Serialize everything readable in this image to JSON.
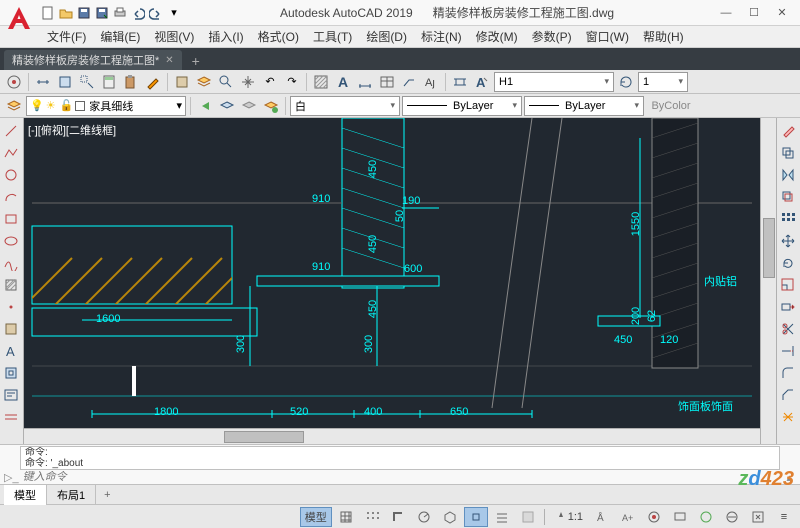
{
  "title": {
    "app": "Autodesk AutoCAD 2019",
    "file": "精装修样板房装修工程施工图.dwg"
  },
  "menus": [
    "文件(F)",
    "编辑(E)",
    "视图(V)",
    "插入(I)",
    "格式(O)",
    "工具(T)",
    "绘图(D)",
    "标注(N)",
    "修改(M)",
    "参数(P)",
    "窗口(W)",
    "帮助(H)"
  ],
  "doctab": {
    "name": "精装修样板房装修工程施工图*"
  },
  "ribbon": {
    "annostyle": "H1",
    "annoscale": "1"
  },
  "props": {
    "layer_name": "家具细线",
    "color_label": "白",
    "ltype": "ByLayer",
    "lweight": "ByLayer",
    "bycolor": "ByColor"
  },
  "viewport_label": "[-][俯视][二维线框]",
  "dims": {
    "d910a": "910",
    "d910b": "910",
    "d190": "190",
    "d50": "50",
    "d600": "600",
    "d450a": "450",
    "d450b": "450",
    "d450c": "450",
    "d450d": "450",
    "d1550": "1550",
    "d62": "62",
    "d200": "200",
    "d120": "120",
    "d1600": "1600",
    "d300a": "300",
    "d300b": "300",
    "d1800": "1800",
    "d520": "520",
    "d400": "400",
    "d650": "650",
    "annot1": "内贴铝",
    "annot2": "饰面板饰面"
  },
  "cmd": {
    "hist1": "命令:",
    "hist2": "命令: '_about",
    "placeholder": "键入命令"
  },
  "model_tabs": {
    "model": "模型",
    "layout1": "布局1"
  },
  "status": {
    "model_btn": "模型",
    "scale": "1:1"
  }
}
